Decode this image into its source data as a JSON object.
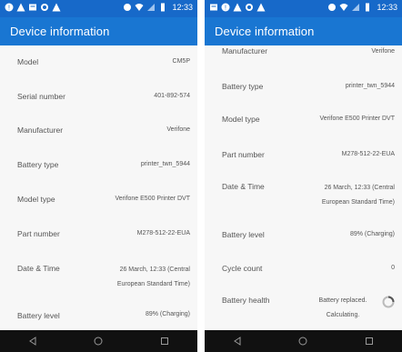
{
  "colors": {
    "status_bar": "#1769c9",
    "app_bar": "#1976d2",
    "background": "#f7f7f7",
    "nav_bar": "#111111",
    "text": "#555555"
  },
  "left": {
    "status": {
      "time": "12:33"
    },
    "title": "Device information",
    "rows": [
      {
        "label": "Model",
        "value": "CM5P"
      },
      {
        "label": "Serial number",
        "value": "401-892-574"
      },
      {
        "label": "Manufacturer",
        "value": "Verifone"
      },
      {
        "label": "Battery type",
        "value": "printer_twn_5944"
      },
      {
        "label": "Model type",
        "value": "Verifone E500 Printer DVT"
      },
      {
        "label": "Part number",
        "value": "M278-512-22-EUA"
      },
      {
        "label": "Date & Time",
        "value": "26 March, 12:33 (Central European Standard Time)"
      },
      {
        "label": "Battery level",
        "value": "89% (Charging)"
      }
    ]
  },
  "right": {
    "status": {
      "time": "12:33"
    },
    "title": "Device information",
    "rows": [
      {
        "label": "Manufacturer",
        "value": "Verifone"
      },
      {
        "label": "Battery type",
        "value": "printer_twn_5944"
      },
      {
        "label": "Model type",
        "value": "Verifone E500 Printer DVT"
      },
      {
        "label": "Part number",
        "value": "M278-512-22-EUA"
      },
      {
        "label": "Date & Time",
        "value": "26 March, 12:33 (Central European Standard Time)"
      },
      {
        "label": "Battery level",
        "value": "89% (Charging)"
      },
      {
        "label": "Cycle count",
        "value": "0"
      },
      {
        "label": "Battery health",
        "value": "Battery replaced. Calculating."
      }
    ]
  },
  "nav": {
    "icons": [
      "back-icon",
      "home-icon",
      "recents-icon"
    ]
  }
}
